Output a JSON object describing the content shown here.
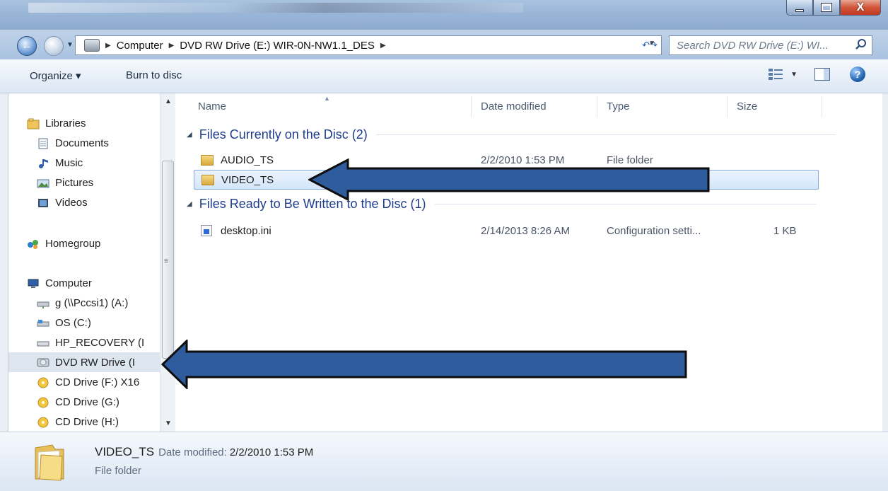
{
  "window": {
    "controls": {
      "minimize": "minimize",
      "maximize": "maximize",
      "close": "X"
    }
  },
  "address": {
    "crumbs": [
      "Computer",
      "DVD RW Drive (E:) WIR-0N-NW1.1_DES"
    ],
    "search_placeholder": "Search DVD RW Drive (E:) WI..."
  },
  "toolbar": {
    "organize": "Organize ▾",
    "burn": "Burn to disc"
  },
  "navpane": {
    "items": [
      {
        "label": "Libraries",
        "icon": "libraries-icon"
      },
      {
        "label": "Documents",
        "icon": "documents-icon"
      },
      {
        "label": "Music",
        "icon": "music-icon"
      },
      {
        "label": "Pictures",
        "icon": "pictures-icon"
      },
      {
        "label": "Videos",
        "icon": "videos-icon"
      },
      {
        "label": "Homegroup",
        "icon": "homegroup-icon"
      },
      {
        "label": "Computer",
        "icon": "computer-icon"
      },
      {
        "label": "g (\\\\Pccsi1) (A:)",
        "icon": "network-drive-icon"
      },
      {
        "label": "OS (C:)",
        "icon": "hard-drive-icon"
      },
      {
        "label": "HP_RECOVERY (I",
        "icon": "drive-icon"
      },
      {
        "label": "DVD RW Drive (I",
        "icon": "dvd-drive-icon"
      },
      {
        "label": "CD Drive (F:) X16",
        "icon": "cd-icon"
      },
      {
        "label": "CD Drive (G:)",
        "icon": "cd-icon"
      },
      {
        "label": "CD Drive (H:)",
        "icon": "cd-icon"
      }
    ]
  },
  "columns": {
    "name": "Name",
    "date": "Date modified",
    "type": "Type",
    "size": "Size"
  },
  "groups": [
    {
      "title": "Files Currently on the Disc (2)",
      "files": [
        {
          "name": "AUDIO_TS",
          "date": "2/2/2010 1:53 PM",
          "type": "File folder",
          "size": ""
        },
        {
          "name": "VIDEO_TS",
          "date": "",
          "type": "",
          "size": ""
        }
      ]
    },
    {
      "title": "Files Ready to Be Written to the Disc (1)",
      "files": [
        {
          "name": "desktop.ini",
          "date": "2/14/2013 8:26 AM",
          "type": "Configuration setti...",
          "size": "1 KB"
        }
      ]
    }
  ],
  "details": {
    "name": "VIDEO_TS",
    "date_label": "Date modified:",
    "date": "2/2/2010 1:53 PM",
    "type": "File folder"
  },
  "colors": {
    "accent_arrow": "#2e5c9c",
    "group_title": "#1e3c8c",
    "selection": "#d4e6fb"
  }
}
